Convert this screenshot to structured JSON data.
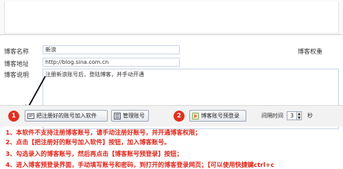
{
  "form": {
    "name_label": "博客名称",
    "name_value": "新浪",
    "weight_label": "博客权重",
    "url_label": "博客地址",
    "url_value": "http://blog.sina.com.cn",
    "desc_label": "博客说明",
    "desc_value": "注册新浪账号后，登陆博客，并手动开通"
  },
  "toolbar": {
    "step1": "1",
    "add_button": "把注册好的账号加入软件",
    "manage_button": "管理账号",
    "step2": "2",
    "prelogin_button": "博客账号预登录",
    "interval_label": "间隔时间",
    "interval_value": "3",
    "seconds_label": "秒"
  },
  "notes": {
    "line1": "1、本软件不支持注册博客账号，请手动注册好账号，并开通博客权限；",
    "line2": "2、点击【把注册好的账号加入软件】按钮，加入博客账号。",
    "line3": "3、勾选录入的博客账号，然后再点击【博客账号预登录】按钮；",
    "line4": "4、进入博客预登录界面，手动填写账号和密码，到打开的博客登录网页；【可以使用快捷键ctrl+c"
  },
  "colors": {
    "accent_red": "#e0281c",
    "field_border": "#c4d3e6"
  }
}
